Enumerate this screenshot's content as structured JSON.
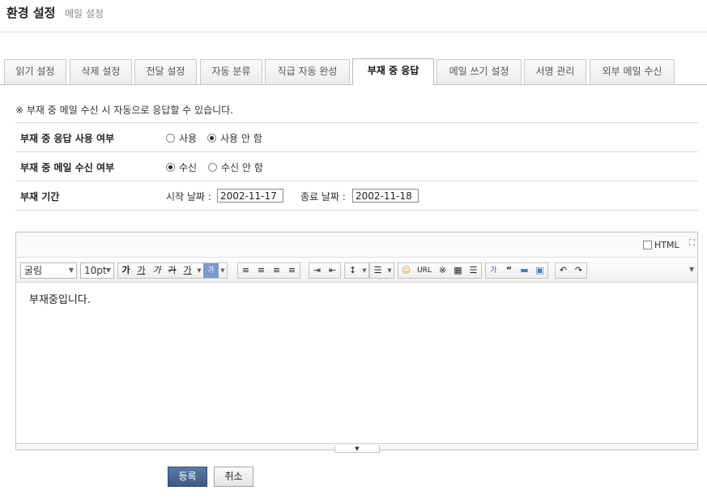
{
  "header": {
    "title": "환경 설정",
    "subtitle": "메일 설정"
  },
  "tabs": [
    {
      "label": "읽기 설정",
      "active": false
    },
    {
      "label": "삭제 설정",
      "active": false
    },
    {
      "label": "전달 설정",
      "active": false
    },
    {
      "label": "자동 분류",
      "active": false
    },
    {
      "label": "직급 자동 완성",
      "active": false
    },
    {
      "label": "부재 중 응답",
      "active": true
    },
    {
      "label": "메일 쓰기 설정",
      "active": false
    },
    {
      "label": "서명 관리",
      "active": false
    },
    {
      "label": "외부 메일 수신",
      "active": false
    }
  ],
  "notice": "※ 부재 중 메일 수신 시 자동으로 응답할 수 있습니다.",
  "form": {
    "auto_reply": {
      "label": "부재 중 응답 사용 여부",
      "options": [
        "사용",
        "사용 안 함"
      ],
      "selected": "사용 안 함"
    },
    "receive": {
      "label": "부재 중 메일 수신 여부",
      "options": [
        "수신",
        "수신 안 함"
      ],
      "selected": "수신"
    },
    "period": {
      "label": "부재 기간",
      "start_label": "시작 날짜 :",
      "start_value": "2002-11-17",
      "end_label": "종료 날짜 :",
      "end_value": "2002-11-18"
    }
  },
  "editor": {
    "html_label": "HTML",
    "font_family": "굴림",
    "font_size": "10pt",
    "toolbar": {
      "bold": "가",
      "underline": "가",
      "italic": "가",
      "strike": "가",
      "font_color": "가",
      "bg_color": "가",
      "url": "URL",
      "asterisk": "※",
      "quote": "“",
      "bgtext": "가"
    },
    "content": "부재중입니다."
  },
  "buttons": {
    "submit": "등록",
    "cancel": "취소"
  }
}
